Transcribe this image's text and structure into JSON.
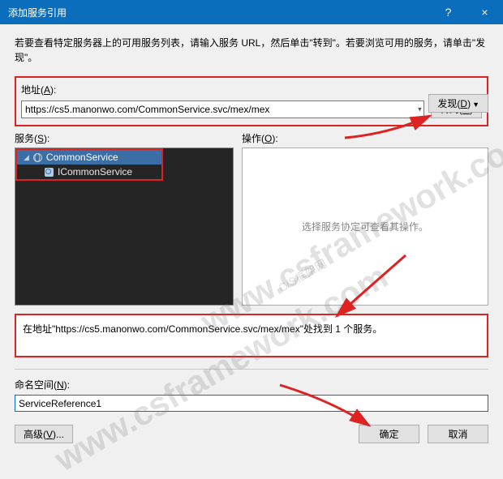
{
  "titlebar": {
    "title": "添加服务引用",
    "help": "?",
    "close": "×"
  },
  "instruction": "若要查看特定服务器上的可用服务列表，请输入服务 URL，然后单击\"转到\"。若要浏览可用的服务，请单击\"发现\"。",
  "address": {
    "label_prefix": "地址(",
    "label_key": "A",
    "label_suffix": "):",
    "value": "https://cs5.manonwo.com/CommonService.svc/mex/mex"
  },
  "go_btn": {
    "pre": "转到(",
    "key": "G",
    "post": ")"
  },
  "discover_btn": {
    "pre": "发现(",
    "key": "D",
    "post": ")"
  },
  "services": {
    "label_pre": "服务(",
    "label_key": "S",
    "label_post": "):",
    "root": "CommonService",
    "child": "ICommonService"
  },
  "operations": {
    "label_pre": "操作(",
    "label_key": "O",
    "label_post": "):",
    "placeholder": "选择服务协定可查看其操作。"
  },
  "status": "在地址\"https://cs5.manonwo.com/CommonService.svc/mex/mex\"处找到 1 个服务。",
  "namespace": {
    "label_pre": "命名空间(",
    "label_key": "N",
    "label_post": "):",
    "value": "ServiceReference1"
  },
  "advanced_btn": {
    "pre": "高级(",
    "key": "V",
    "post": ")..."
  },
  "ok_btn": "确定",
  "cancel_btn": "取消",
  "watermark_main": "www.csframework.com",
  "watermark_sub": "C/S框架网"
}
